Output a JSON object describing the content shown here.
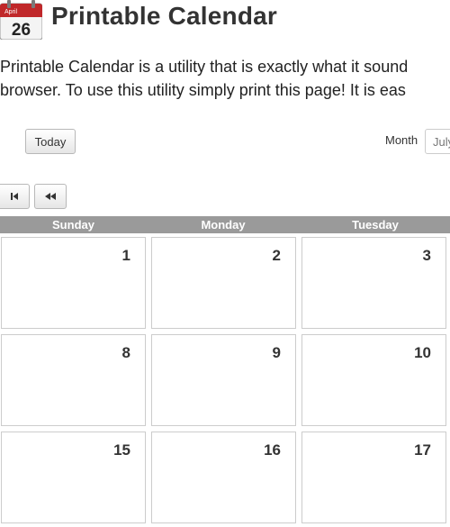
{
  "header": {
    "icon_month": "April",
    "icon_day": "26",
    "title": "Printable Calendar"
  },
  "intro": {
    "line1": "Printable Calendar is a utility that is exactly what it sound",
    "line2": "browser. To use this utility simply print this page! It is eas"
  },
  "toolbar": {
    "today_label": "Today",
    "month_label": "Month",
    "month_value": "July",
    "first_icon": "skip-first-icon",
    "prev_icon": "double-chevron-left-icon"
  },
  "weekdays": [
    "Sunday",
    "Monday",
    "Tuesday"
  ],
  "weeks": [
    [
      "1",
      "2",
      "3"
    ],
    [
      "8",
      "9",
      "10"
    ],
    [
      "15",
      "16",
      "17"
    ]
  ],
  "colors": {
    "icon_red": "#c0282a",
    "header_gray": "#9a9a9a",
    "cell_border": "#cccccc"
  }
}
